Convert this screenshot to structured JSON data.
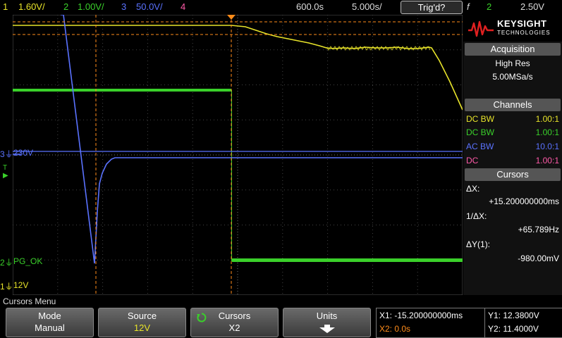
{
  "colors": {
    "ch1": "#e8e42a",
    "ch2": "#3ad02a",
    "ch3": "#5a72ff",
    "ch4": "#ff5aa8",
    "cursor": "#ff8c1a"
  },
  "topbar": {
    "ch1_num": "1",
    "ch1_scale": "1.60V/",
    "ch2_num": "2",
    "ch2_scale": "1.00V/",
    "ch3_num": "3",
    "ch3_scale": "50.0V/",
    "ch4_num": "4",
    "time_pos": "600.0s",
    "time_scale": "5.000s/",
    "trig_status": "Trig'd?",
    "trig_icon": "f",
    "trig_ch": "2",
    "trig_level": "2.50V"
  },
  "sidebar": {
    "brand": "KEYSIGHT",
    "brand_sub": "TECHNOLOGIES",
    "acq_header": "Acquisition",
    "acq_mode": "High Res",
    "acq_rate": "5.00MSa/s",
    "channels_header": "Channels",
    "channels": [
      {
        "coupling": "DC  BW",
        "ratio": "1.00:1"
      },
      {
        "coupling": "DC  BW",
        "ratio": "1.00:1"
      },
      {
        "coupling": "AC  BW",
        "ratio": "10.0:1"
      },
      {
        "coupling": "DC",
        "ratio": "1.00:1"
      }
    ],
    "cursors_header": "Cursors",
    "dx_label": "ΔX:",
    "dx_value": "+15.200000000ms",
    "inv_dx_label": "1/ΔX:",
    "inv_dx_value": "+65.789Hz",
    "dy_label": "ΔY(1):",
    "dy_value": "-980.00mV"
  },
  "screen_labels": {
    "ch3_label": "230V",
    "ch2_label": "PG_OK",
    "ch1_label": "12V"
  },
  "menu": {
    "title": "Cursors Menu",
    "softkeys": [
      {
        "title": "Mode",
        "value": "Manual"
      },
      {
        "title": "Source",
        "value": "12V"
      },
      {
        "title": "Cursors",
        "value": "X2"
      },
      {
        "title": "Units",
        "value": ""
      }
    ]
  },
  "cursor_readout": {
    "x1": "X1: -15.200000000ms",
    "x2": "X2: 0.0s",
    "y1": "Y1: 12.3800V",
    "y2": "Y2: 11.4000V"
  }
}
